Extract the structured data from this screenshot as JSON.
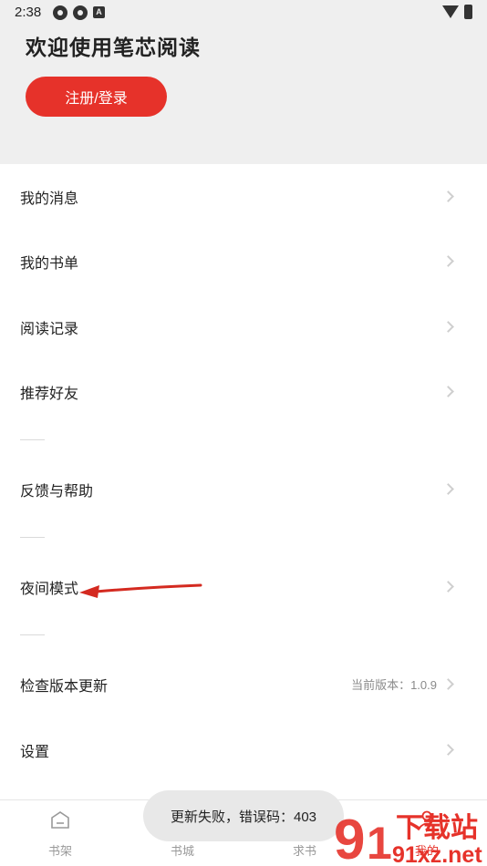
{
  "status_bar": {
    "time": "2:38",
    "app_icons": [
      "gear-icon",
      "gear-icon",
      "a-icon"
    ],
    "right_icons": [
      "wifi-icon",
      "battery-icon"
    ]
  },
  "header": {
    "welcome": "欢迎使用笔芯阅读",
    "login_button": "注册/登录"
  },
  "menu": {
    "items": [
      {
        "label": "我的消息"
      },
      {
        "label": "我的书单"
      },
      {
        "label": "阅读记录"
      },
      {
        "label": "推荐好友"
      },
      {
        "label": "反馈与帮助"
      },
      {
        "label": "夜间模式"
      },
      {
        "label": "检查版本更新",
        "value": "当前版本：1.0.9"
      },
      {
        "label": "设置"
      }
    ]
  },
  "tabs": [
    {
      "label": "书架",
      "icon": "bookshelf-icon"
    },
    {
      "label": "书城",
      "icon": "bookstore-icon"
    },
    {
      "label": "求书",
      "icon": "request-icon"
    },
    {
      "label": "我的",
      "icon": "profile-icon"
    }
  ],
  "toast": {
    "text": "更新失败，错误码：403"
  },
  "watermark": {
    "text1": "下载站",
    "text2": "91xz.net"
  },
  "colors": {
    "accent": "#e6322a",
    "header_bg": "#efefef",
    "chevron": "#cfcfcf"
  }
}
